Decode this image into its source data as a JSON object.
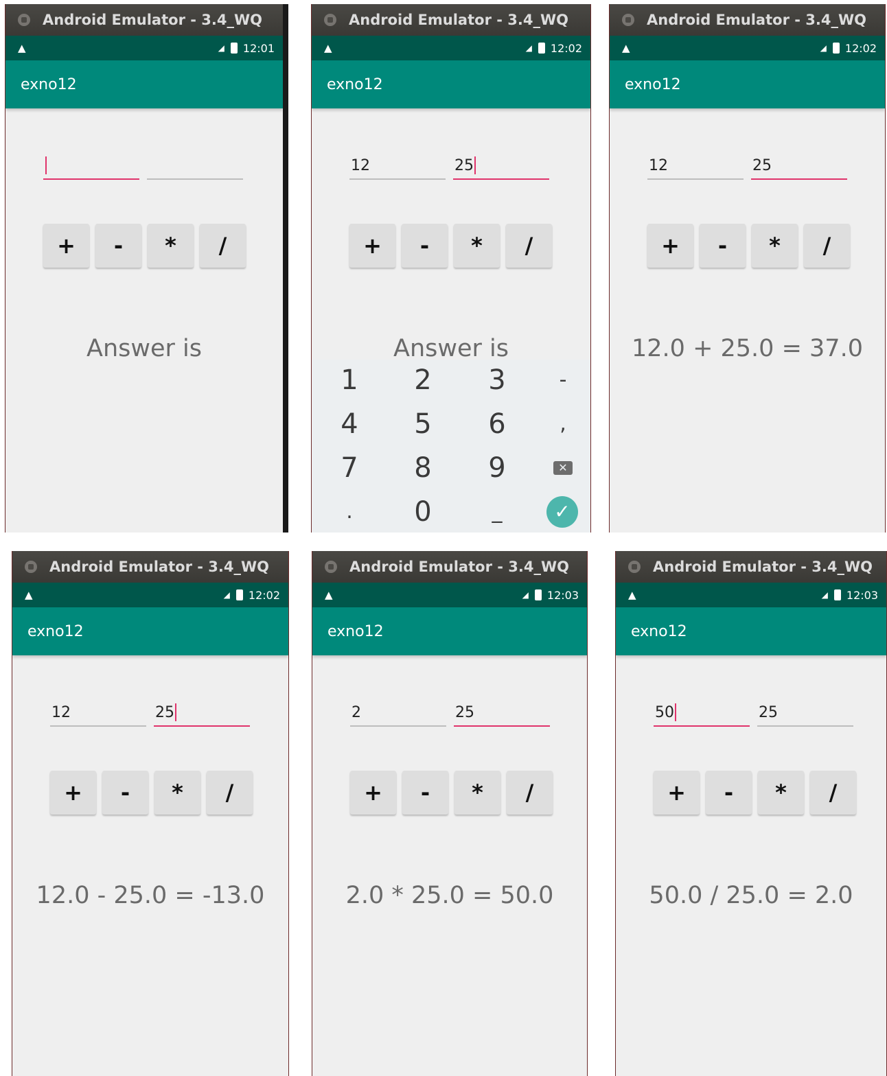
{
  "window_title": "Android Emulator - 3.4_WQ",
  "app_title": "exno12",
  "operators": [
    "+",
    "-",
    "*",
    "/"
  ],
  "keypad_keys": [
    "1",
    "2",
    "3",
    "-",
    "4",
    "5",
    "6",
    ",",
    "7",
    "8",
    "9",
    "",
    ".",
    "0",
    "_",
    ""
  ],
  "screens": [
    {
      "time": "12:01",
      "input1": "",
      "input2": "",
      "focus": 1,
      "answer": "Answer is",
      "keypad": false
    },
    {
      "time": "12:02",
      "input1": "12",
      "input2": "25",
      "focus": 2,
      "answer": "Answer is",
      "keypad": true
    },
    {
      "time": "12:02",
      "input1": "12",
      "input2": "25",
      "focus": 2,
      "answer": "12.0 + 25.0 = 37.0",
      "keypad": false
    },
    {
      "time": "12:02",
      "input1": "12",
      "input2": "25",
      "focus": 2,
      "answer": "12.0 - 25.0 = -13.0",
      "keypad": false
    },
    {
      "time": "12:03",
      "input1": "2",
      "input2": "25",
      "focus": 2,
      "answer": "2.0 * 25.0 = 50.0",
      "keypad": false
    },
    {
      "time": "12:03",
      "input1": "50",
      "input2": "25",
      "focus": 1,
      "answer": "50.0 / 25.0 = 2.0",
      "keypad": false
    }
  ],
  "colors": {
    "status_bar": "#00574b",
    "app_bar": "#00897b",
    "accent": "#e0336b",
    "done_key": "#4db6ac"
  }
}
